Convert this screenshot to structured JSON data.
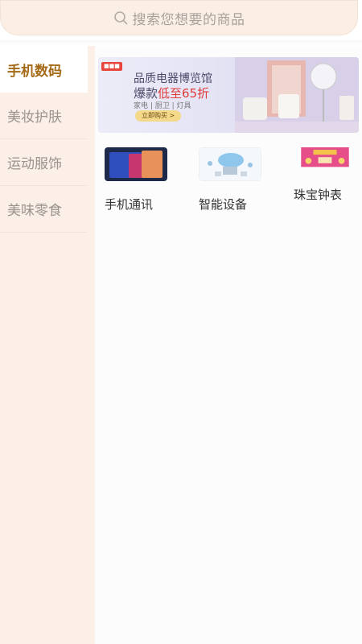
{
  "search": {
    "placeholder": "搜索您想要的商品"
  },
  "sidebar": {
    "items": [
      {
        "label": "手机数码",
        "active": true
      },
      {
        "label": "美妆护肤",
        "active": false
      },
      {
        "label": "运动服饰",
        "active": false
      },
      {
        "label": "美味零食",
        "active": false
      }
    ]
  },
  "banner": {
    "title": "品质电器博览馆",
    "sub_prefix": "爆款",
    "sub_highlight": "低至65折",
    "categories": "家电 | 厨卫 | 灯具",
    "button": "立即购买 >"
  },
  "categories": [
    {
      "label": "手机通讯",
      "icon": "phone-image"
    },
    {
      "label": "智能设备",
      "icon": "smart-device-image"
    },
    {
      "label": "珠宝钟表",
      "icon": "jewelry-image"
    }
  ],
  "colors": {
    "accent": "#a56a17",
    "sidebar_bg": "#fbefe7",
    "search_bg": "#fbeee4"
  }
}
